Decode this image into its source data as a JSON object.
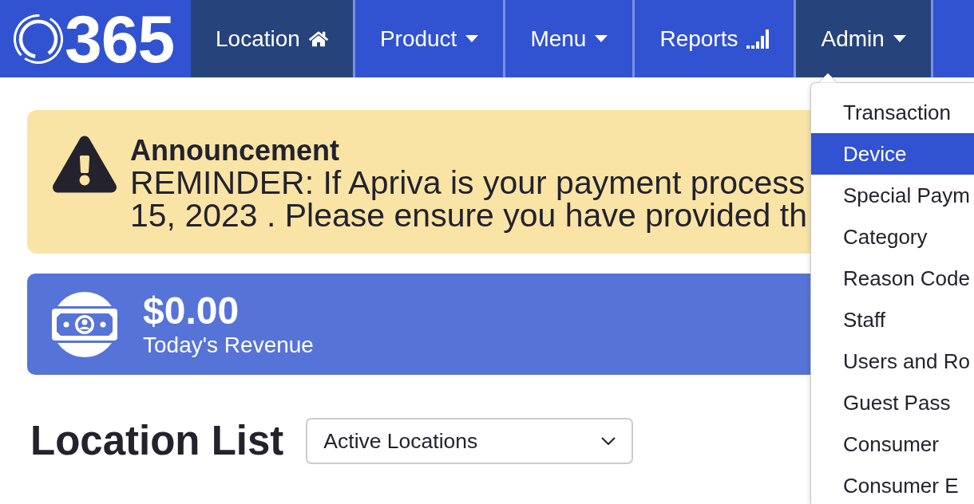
{
  "navbar": {
    "logo": {
      "text": "365"
    },
    "items": [
      {
        "label": "Location",
        "kind": "home",
        "selected": true,
        "expanded": false
      },
      {
        "label": "Product",
        "kind": "dropdown",
        "selected": false,
        "expanded": false
      },
      {
        "label": "Menu",
        "kind": "dropdown",
        "selected": false,
        "expanded": false
      },
      {
        "label": "Reports",
        "kind": "reports",
        "selected": false,
        "expanded": false
      },
      {
        "label": "Admin",
        "kind": "dropdown",
        "selected": true,
        "expanded": true
      }
    ]
  },
  "announcement": {
    "title": "Announcement",
    "lines": [
      "REMINDER: If Apriva is your payment process",
      "15, 2023 . Please ensure you have provided th"
    ]
  },
  "revenue": {
    "amount": "$0.00",
    "label": "Today's Revenue"
  },
  "location_list": {
    "title": "Location List",
    "filter": {
      "value": "Active Locations"
    }
  },
  "admin_menu": {
    "items": [
      {
        "label": "Transaction",
        "selected": false
      },
      {
        "label": "Device",
        "selected": true
      },
      {
        "label": "Special Paym",
        "selected": false
      },
      {
        "label": "Category",
        "selected": false
      },
      {
        "label": "Reason Code",
        "selected": false
      },
      {
        "label": "Staff",
        "selected": false
      },
      {
        "label": "Users and Ro",
        "selected": false
      },
      {
        "label": "Guest Pass",
        "selected": false
      },
      {
        "label": "Consumer",
        "selected": false
      },
      {
        "label": "Consumer E",
        "selected": false
      }
    ]
  }
}
